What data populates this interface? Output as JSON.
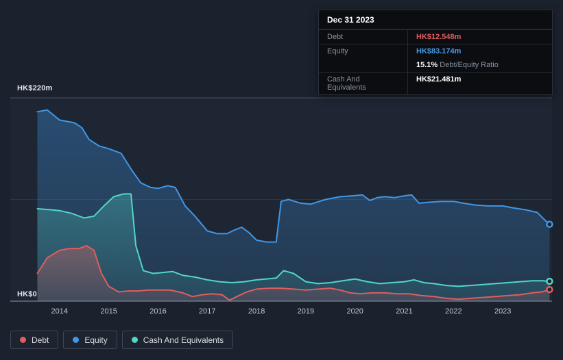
{
  "tooltip": {
    "date": "Dec 31 2023",
    "debt_label": "Debt",
    "debt_value": "HK$12.548m",
    "equity_label": "Equity",
    "equity_value": "HK$83.174m",
    "ratio_value": "15.1%",
    "ratio_label": "Debt/Equity Ratio",
    "cash_label": "Cash And Equivalents",
    "cash_value": "HK$21.481m"
  },
  "legend": {
    "items": [
      {
        "label": "Debt",
        "color": "#e05e5e"
      },
      {
        "label": "Equity",
        "color": "#3f97e8"
      },
      {
        "label": "Cash And Equivalents",
        "color": "#52d7c5"
      }
    ]
  },
  "chart_data": {
    "type": "area",
    "xlim": [
      2013,
      2024
    ],
    "ylim": [
      0,
      220
    ],
    "y_gridlines": [
      0,
      110,
      220
    ],
    "y_axis_labels": {
      "max": "HK$220m",
      "zero": "HK$0"
    },
    "x_ticks": [
      2014,
      2015,
      2016,
      2017,
      2018,
      2019,
      2020,
      2021,
      2022,
      2023
    ],
    "legend_position": "bottom-left",
    "grid": "horizontal-only",
    "end_values": {
      "debt_m": 12.548,
      "equity_m": 83.174,
      "cash_m": 21.481,
      "debt_equity_ratio_pct": 15.1
    },
    "series": [
      {
        "name": "Equity",
        "color": "#3f97e8",
        "fill_opacity": [
          0.34,
          0.16
        ],
        "x": [
          2013.55,
          2013.75,
          2014.0,
          2014.3,
          2014.45,
          2014.6,
          2014.8,
          2015.0,
          2015.25,
          2015.45,
          2015.65,
          2015.85,
          2016.0,
          2016.2,
          2016.35,
          2016.55,
          2016.75,
          2017.0,
          2017.2,
          2017.4,
          2017.55,
          2017.7,
          2017.85,
          2018.0,
          2018.2,
          2018.4,
          2018.5,
          2018.65,
          2018.9,
          2019.1,
          2019.4,
          2019.7,
          2019.95,
          2020.15,
          2020.3,
          2020.45,
          2020.6,
          2020.8,
          2021.0,
          2021.15,
          2021.3,
          2021.5,
          2021.75,
          2022.0,
          2022.2,
          2022.45,
          2022.7,
          2023.0,
          2023.2,
          2023.45,
          2023.7,
          2023.85,
          2023.95
        ],
        "values": [
          205,
          207,
          196,
          193,
          188,
          175,
          168,
          165,
          160,
          143,
          128,
          123,
          122,
          125,
          123,
          103,
          92,
          76,
          73,
          73,
          77,
          80,
          74,
          66,
          64,
          64,
          108,
          110,
          106,
          105,
          110,
          113,
          114,
          115,
          109,
          112,
          113,
          112,
          114,
          115,
          106,
          107,
          108,
          108,
          106,
          104,
          103,
          103,
          101,
          99,
          96,
          88,
          83.2
        ]
      },
      {
        "name": "Cash And Equivalents",
        "color": "#52d7c5",
        "fill_opacity": [
          0.3,
          0.1
        ],
        "x": [
          2013.55,
          2013.8,
          2014.0,
          2014.25,
          2014.5,
          2014.7,
          2014.9,
          2015.1,
          2015.3,
          2015.45,
          2015.55,
          2015.7,
          2015.9,
          2016.1,
          2016.3,
          2016.5,
          2016.75,
          2017.0,
          2017.25,
          2017.5,
          2017.75,
          2018.0,
          2018.2,
          2018.4,
          2018.55,
          2018.75,
          2019.0,
          2019.25,
          2019.5,
          2019.75,
          2020.0,
          2020.25,
          2020.5,
          2020.75,
          2021.0,
          2021.2,
          2021.4,
          2021.6,
          2021.85,
          2022.1,
          2022.35,
          2022.6,
          2022.85,
          2023.1,
          2023.35,
          2023.6,
          2023.8,
          2023.95
        ],
        "values": [
          100,
          99,
          98,
          95,
          90,
          92,
          103,
          113,
          116,
          116,
          60,
          33,
          30,
          31,
          32,
          28,
          26,
          23,
          21,
          20,
          21,
          23,
          24,
          25,
          33,
          30,
          21,
          19,
          20,
          22,
          24,
          21,
          19,
          20,
          21,
          23,
          20,
          19,
          17,
          16,
          17,
          18,
          19,
          20,
          21,
          22,
          22,
          21.5
        ]
      },
      {
        "name": "Debt",
        "color": "#e05e5e",
        "fill_opacity": [
          0.38,
          0.14
        ],
        "x": [
          2013.55,
          2013.75,
          2014.0,
          2014.2,
          2014.4,
          2014.55,
          2014.7,
          2014.85,
          2015.0,
          2015.2,
          2015.4,
          2015.6,
          2015.8,
          2016.0,
          2016.25,
          2016.5,
          2016.7,
          2016.9,
          2017.1,
          2017.3,
          2017.45,
          2017.6,
          2017.8,
          2018.0,
          2018.25,
          2018.5,
          2018.75,
          2019.0,
          2019.25,
          2019.5,
          2019.7,
          2019.9,
          2020.1,
          2020.35,
          2020.6,
          2020.85,
          2021.1,
          2021.35,
          2021.6,
          2021.85,
          2022.1,
          2022.35,
          2022.6,
          2022.85,
          2023.1,
          2023.35,
          2023.6,
          2023.8,
          2023.95
        ],
        "values": [
          30,
          47,
          55,
          57,
          57,
          60,
          55,
          30,
          16,
          10,
          11,
          11,
          12,
          12,
          12,
          9,
          5,
          7,
          8,
          7,
          1,
          5,
          10,
          13,
          14,
          14,
          13,
          12,
          13,
          14,
          12,
          9,
          8,
          9,
          9,
          8,
          8,
          6,
          5,
          3,
          2,
          3,
          4,
          5,
          6,
          7,
          9,
          10,
          12.5
        ]
      }
    ]
  }
}
